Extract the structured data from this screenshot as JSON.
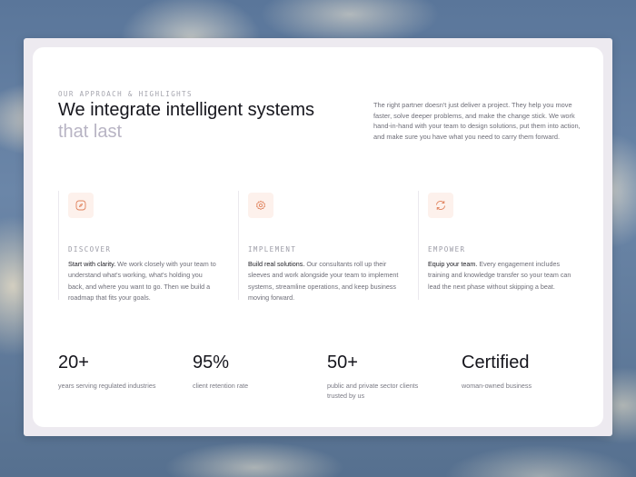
{
  "section": {
    "eyebrow": "OUR APPROACH & HIGHLIGHTS",
    "headline_main": "We integrate intelligent systems",
    "headline_muted": "that last",
    "intro": "The right partner doesn't just deliver a project. They help you move faster, solve deeper problems, and make the change stick. We work hand-in-hand with your team to design solutions, put them into action, and make sure you have what you need to carry them forward."
  },
  "steps": [
    {
      "icon": "compass-icon",
      "title": "DISCOVER",
      "lead": "Start with clarity.",
      "body": " We work closely with your team to understand what's working, what's holding you back, and where you want to go. Then we build a roadmap that fits your goals."
    },
    {
      "icon": "gear-icon",
      "title": "IMPLEMENT",
      "lead": "Build real solutions.",
      "body": " Our consultants roll up their sleeves and work alongside your team to implement systems, streamline operations, and keep business moving forward."
    },
    {
      "icon": "refresh-icon",
      "title": "EMPOWER",
      "lead": "Equip your team.",
      "body": " Every engagement includes training and knowledge transfer so your team can lead the next phase without skipping a beat."
    }
  ],
  "stats": [
    {
      "value": "20+",
      "label": "years serving regulated industries"
    },
    {
      "value": "95%",
      "label": "client retention rate"
    },
    {
      "value": "50+",
      "label": "public and private sector clients trusted by us"
    },
    {
      "value": "Certified",
      "label": "woman-owned business"
    }
  ],
  "colors": {
    "accent": "#e0825c",
    "accent_bg": "#fdf1ec",
    "text": "#16161d",
    "muted_headline": "#b8b4c4"
  }
}
